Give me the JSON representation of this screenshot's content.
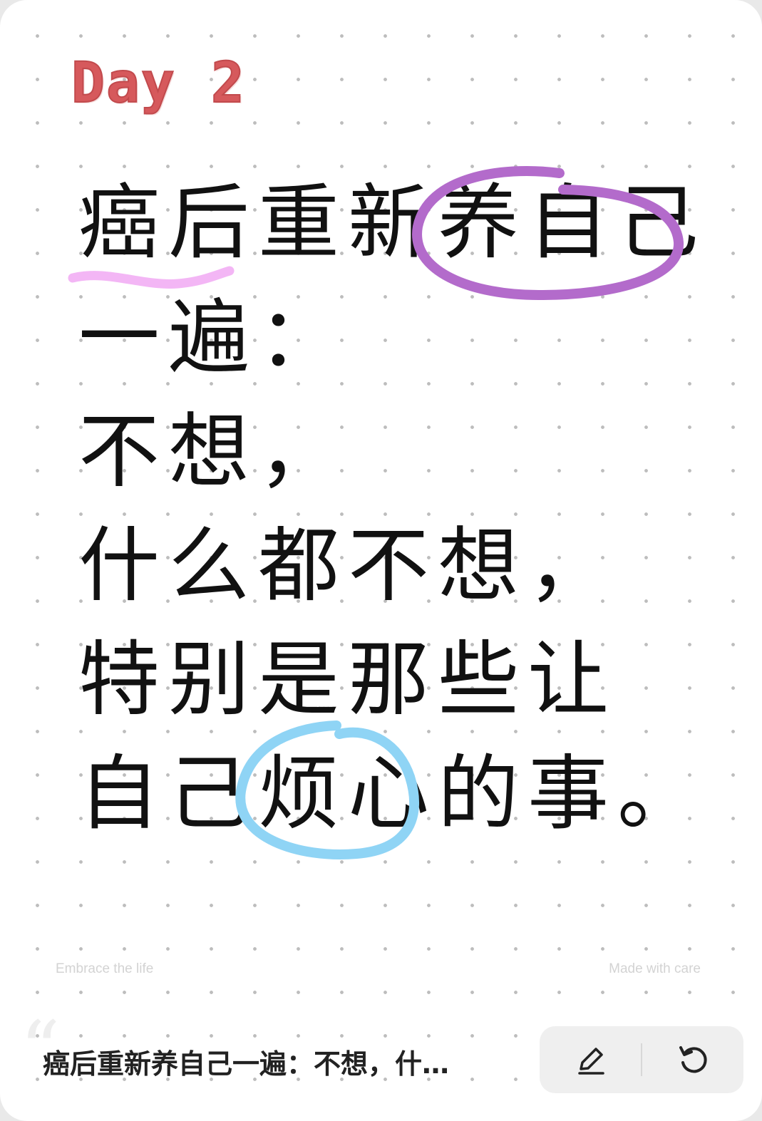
{
  "card": {
    "day_label": "Day 2",
    "lines": [
      "癌后重新养自己",
      "一遍：",
      "不想，",
      "什么都不想，",
      "特别是那些让",
      "自己烦心的事。"
    ],
    "highlights": {
      "underline_color": "#f3b6f5",
      "circle1_color": "#b36bcb",
      "circle2_color": "#8fd4f5"
    },
    "footer_left": "Embrace the life",
    "footer_right": "Made with care"
  },
  "bottom_bar": {
    "preview_text": "癌后重新养自己一遍：不想，什…",
    "edit_icon": "pencil-icon",
    "regenerate_icon": "refresh-icon"
  }
}
